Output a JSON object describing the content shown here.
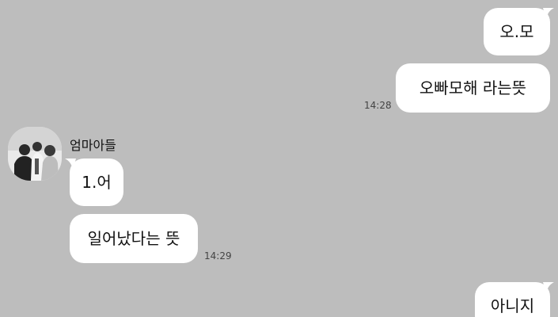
{
  "conversation": {
    "outgoing_group_1": {
      "messages": [
        "오.모",
        "오빠모해 라는뜻"
      ],
      "time": "14:28"
    },
    "incoming_group": {
      "sender_name": "엄마아들",
      "messages": [
        "1.어",
        "일어났다는 뜻"
      ],
      "time": "14:29"
    },
    "outgoing_group_2": {
      "messages": [
        "아니지"
      ]
    }
  }
}
